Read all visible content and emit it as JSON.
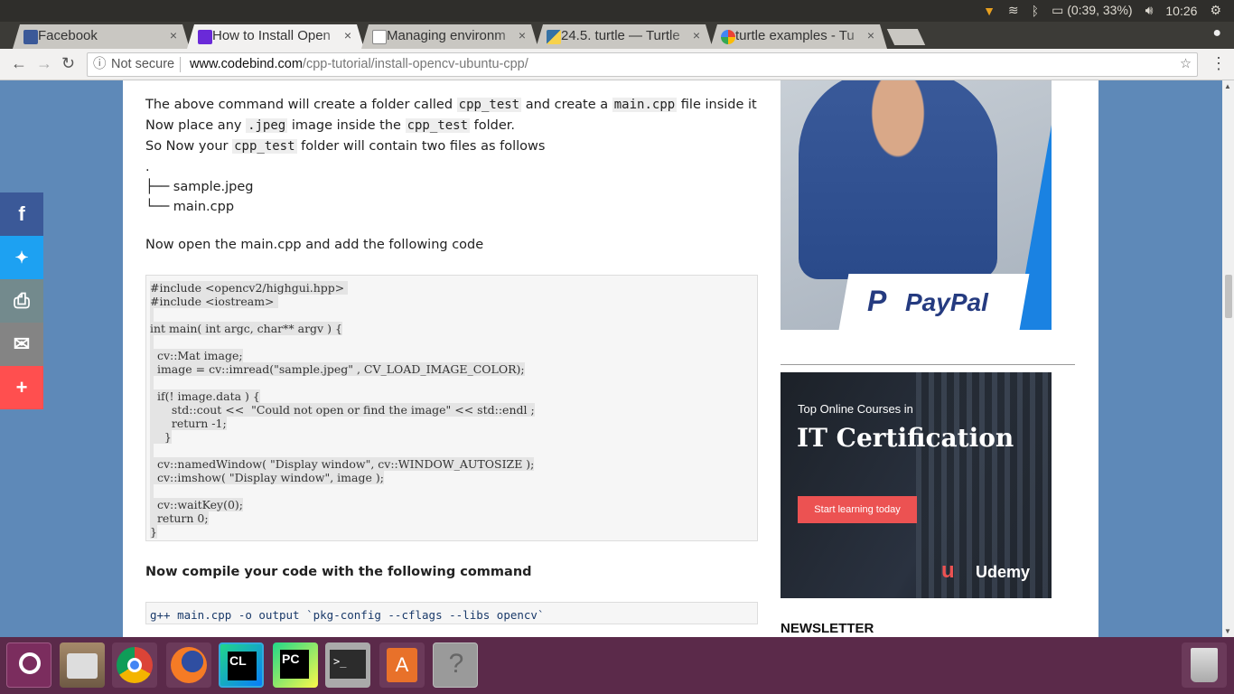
{
  "system_bar": {
    "battery": "(0:39, 33%)",
    "clock": "10:26"
  },
  "tabs": [
    {
      "title": "Facebook",
      "color": "#3b5998",
      "close": "×"
    },
    {
      "title": "How to Install Open",
      "color": "#6a2ad8",
      "close": "×"
    },
    {
      "title": "Managing environm",
      "color": "#888888",
      "close": "×"
    },
    {
      "title": "24.5. turtle — Turtle",
      "color": "#3572a5",
      "close": "×"
    },
    {
      "title": "turtle examples - Tu",
      "color": "#4285f4",
      "close": "×"
    }
  ],
  "address_bar": {
    "security": "Not secure",
    "domain": "www.codebind.com",
    "path": "/cpp-tutorial/install-opencv-ubuntu-cpp/"
  },
  "article": {
    "line1_a": "The above command will create a folder called ",
    "line1_code1": "cpp_test",
    "line1_b": " and create a ",
    "line1_code2": "main.cpp",
    "line1_c": " file inside it",
    "line2_a": "Now place any ",
    "line2_code1": ".jpeg",
    "line2_b": " image inside the ",
    "line2_code2": "cpp_test",
    "line2_c": " folder.",
    "line3_a": "So Now your ",
    "line3_code": "cpp_test",
    "line3_b": " folder will contain two files as follows",
    "tree_root": ".",
    "tree_item1": "├── sample.jpeg",
    "tree_item2": "└── main.cpp",
    "open_text": "Now open the main.cpp and add the following code",
    "code_lines": [
      "#include <opencv2/highgui.hpp> ",
      "#include <iostream> ",
      " ",
      "int main( int argc, char** argv ) {",
      " ",
      "  cv::Mat image;",
      "  image = cv::imread(\"sample.jpeg\" , CV_LOAD_IMAGE_COLOR);",
      " ",
      "  if(! image.data ) {",
      "      std::cout <<  \"Could not open or find the image\" << std::endl ;",
      "      return -1;",
      "    }",
      " ",
      "  cv::namedWindow( \"Display window\", cv::WINDOW_AUTOSIZE );",
      "  cv::imshow( \"Display window\", image );",
      " ",
      "  cv::waitKey(0);",
      "  return 0;",
      "}"
    ],
    "compile_heading": "Now compile your code with the following command",
    "compile_cmd": "g++ main.cpp -o output `pkg-config --cflags --libs opencv`"
  },
  "sidebar": {
    "ad1_brand": "PayPal",
    "ad2_small": "Top Online Courses in",
    "ad2_big": "IT Certification",
    "ad2_button": "Start learning today",
    "ad2_brand": "Udemy",
    "newsletter": "NEWSLETTER"
  },
  "share_buttons": [
    {
      "name": "facebook",
      "color": "#3b5998",
      "glyph": "f"
    },
    {
      "name": "twitter",
      "color": "#1da1f2",
      "glyph": "🐦"
    },
    {
      "name": "print",
      "color": "#738a8d",
      "glyph": "⎙"
    },
    {
      "name": "email",
      "color": "#848484",
      "glyph": "✉"
    },
    {
      "name": "more",
      "color": "#ff4f4f",
      "glyph": "+"
    }
  ],
  "dock": [
    {
      "name": "ubuntu-dash-icon",
      "color": "#7b2d5e"
    },
    {
      "name": "files-icon",
      "color": "#a68a6a"
    },
    {
      "name": "chrome-icon",
      "color": "#e8e8e8"
    },
    {
      "name": "firefox-icon",
      "color": "#f57b25"
    },
    {
      "name": "clion-icon",
      "color": "#21d789"
    },
    {
      "name": "pycharm-icon",
      "color": "#21d789"
    },
    {
      "name": "terminal-icon",
      "color": "#2c2c2c"
    },
    {
      "name": "software-center-icon",
      "color": "#e8712a"
    },
    {
      "name": "help-icon",
      "color": "#9a9a9a"
    },
    {
      "name": "trash-icon",
      "color": "#b0b0b0"
    }
  ],
  "dock_labels": {
    "clion": "CL",
    "pycharm": "PC",
    "terminal": ">_",
    "software": "A",
    "help": "?"
  }
}
